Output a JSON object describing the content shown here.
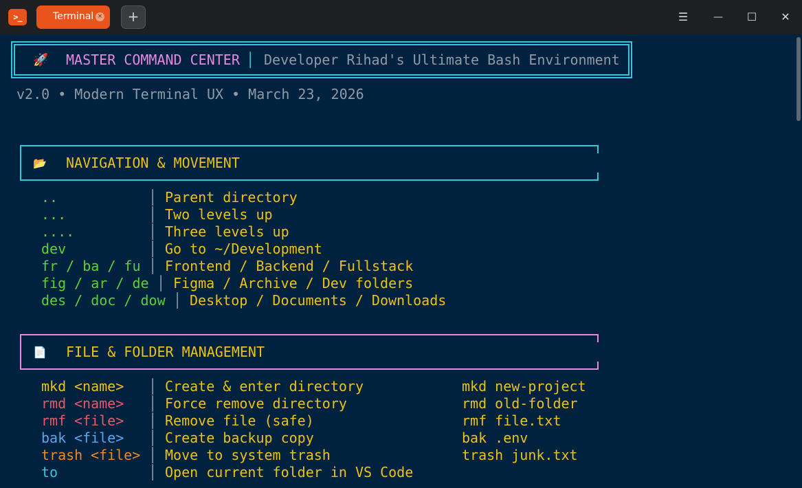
{
  "window": {
    "app_icon": "terminal-app-icon",
    "tab_label": "Terminal",
    "tab_close": "×",
    "new_tab": "+",
    "controls": {
      "menu": "☰",
      "minimize": "—",
      "maximize": "☐",
      "close": "✕"
    }
  },
  "banner": {
    "icon": "🚀",
    "title": "MASTER COMMAND CENTER",
    "separator": "│",
    "subtitle": "Developer Rihad's Ultimate Bash Environment",
    "version_line": "v2.0 • Modern Terminal UX • March 23, 2026"
  },
  "sections": [
    {
      "icon": "📂",
      "title": "NAVIGATION & MOVEMENT",
      "rows": [
        {
          "cmd": "..",
          "desc": "Parent directory"
        },
        {
          "cmd": "...",
          "desc": "Two levels up"
        },
        {
          "cmd": "....",
          "desc": "Three levels up"
        },
        {
          "cmd": "dev",
          "desc": "Go to ~/Development"
        },
        {
          "cmd": "fr / ba / fu",
          "desc": "Frontend / Backend / Fullstack"
        },
        {
          "cmd": "fig / ar / de",
          "desc": "Figma / Archive / Dev folders"
        },
        {
          "cmd": "des / doc / dow",
          "desc": "Desktop / Documents / Downloads"
        }
      ]
    },
    {
      "icon": "📄",
      "title": "FILE & FOLDER MANAGEMENT",
      "rows": [
        {
          "cmd": "mkd",
          "arg": "<name>",
          "desc": "Create & enter directory",
          "example": "mkd new-project"
        },
        {
          "cmd": "rmd",
          "arg": "<name>",
          "desc": "Force remove directory",
          "example": "rmd old-folder"
        },
        {
          "cmd": "rmf",
          "arg": "<file>",
          "desc": "Remove file (safe)",
          "example": "rmf file.txt"
        },
        {
          "cmd": "bak",
          "arg": "<file>",
          "desc": "Create backup copy",
          "example": "bak .env"
        },
        {
          "cmd": "trash",
          "arg": "<file>",
          "desc": "Move to system trash",
          "example": "trash junk.txt"
        },
        {
          "cmd": "to",
          "arg": "",
          "desc": "Open current folder in VS Code",
          "example": ""
        }
      ]
    }
  ],
  "colors": {
    "terminal_bg": "#01223f",
    "accent_orange": "#e8541c",
    "cyan": "#33c7db",
    "pink": "#e58ae0",
    "yellow": "#ebc215",
    "green": "#5ad13a",
    "red": "#e8586b",
    "blue": "#5aa7ef",
    "orange": "#ef8a1e"
  }
}
